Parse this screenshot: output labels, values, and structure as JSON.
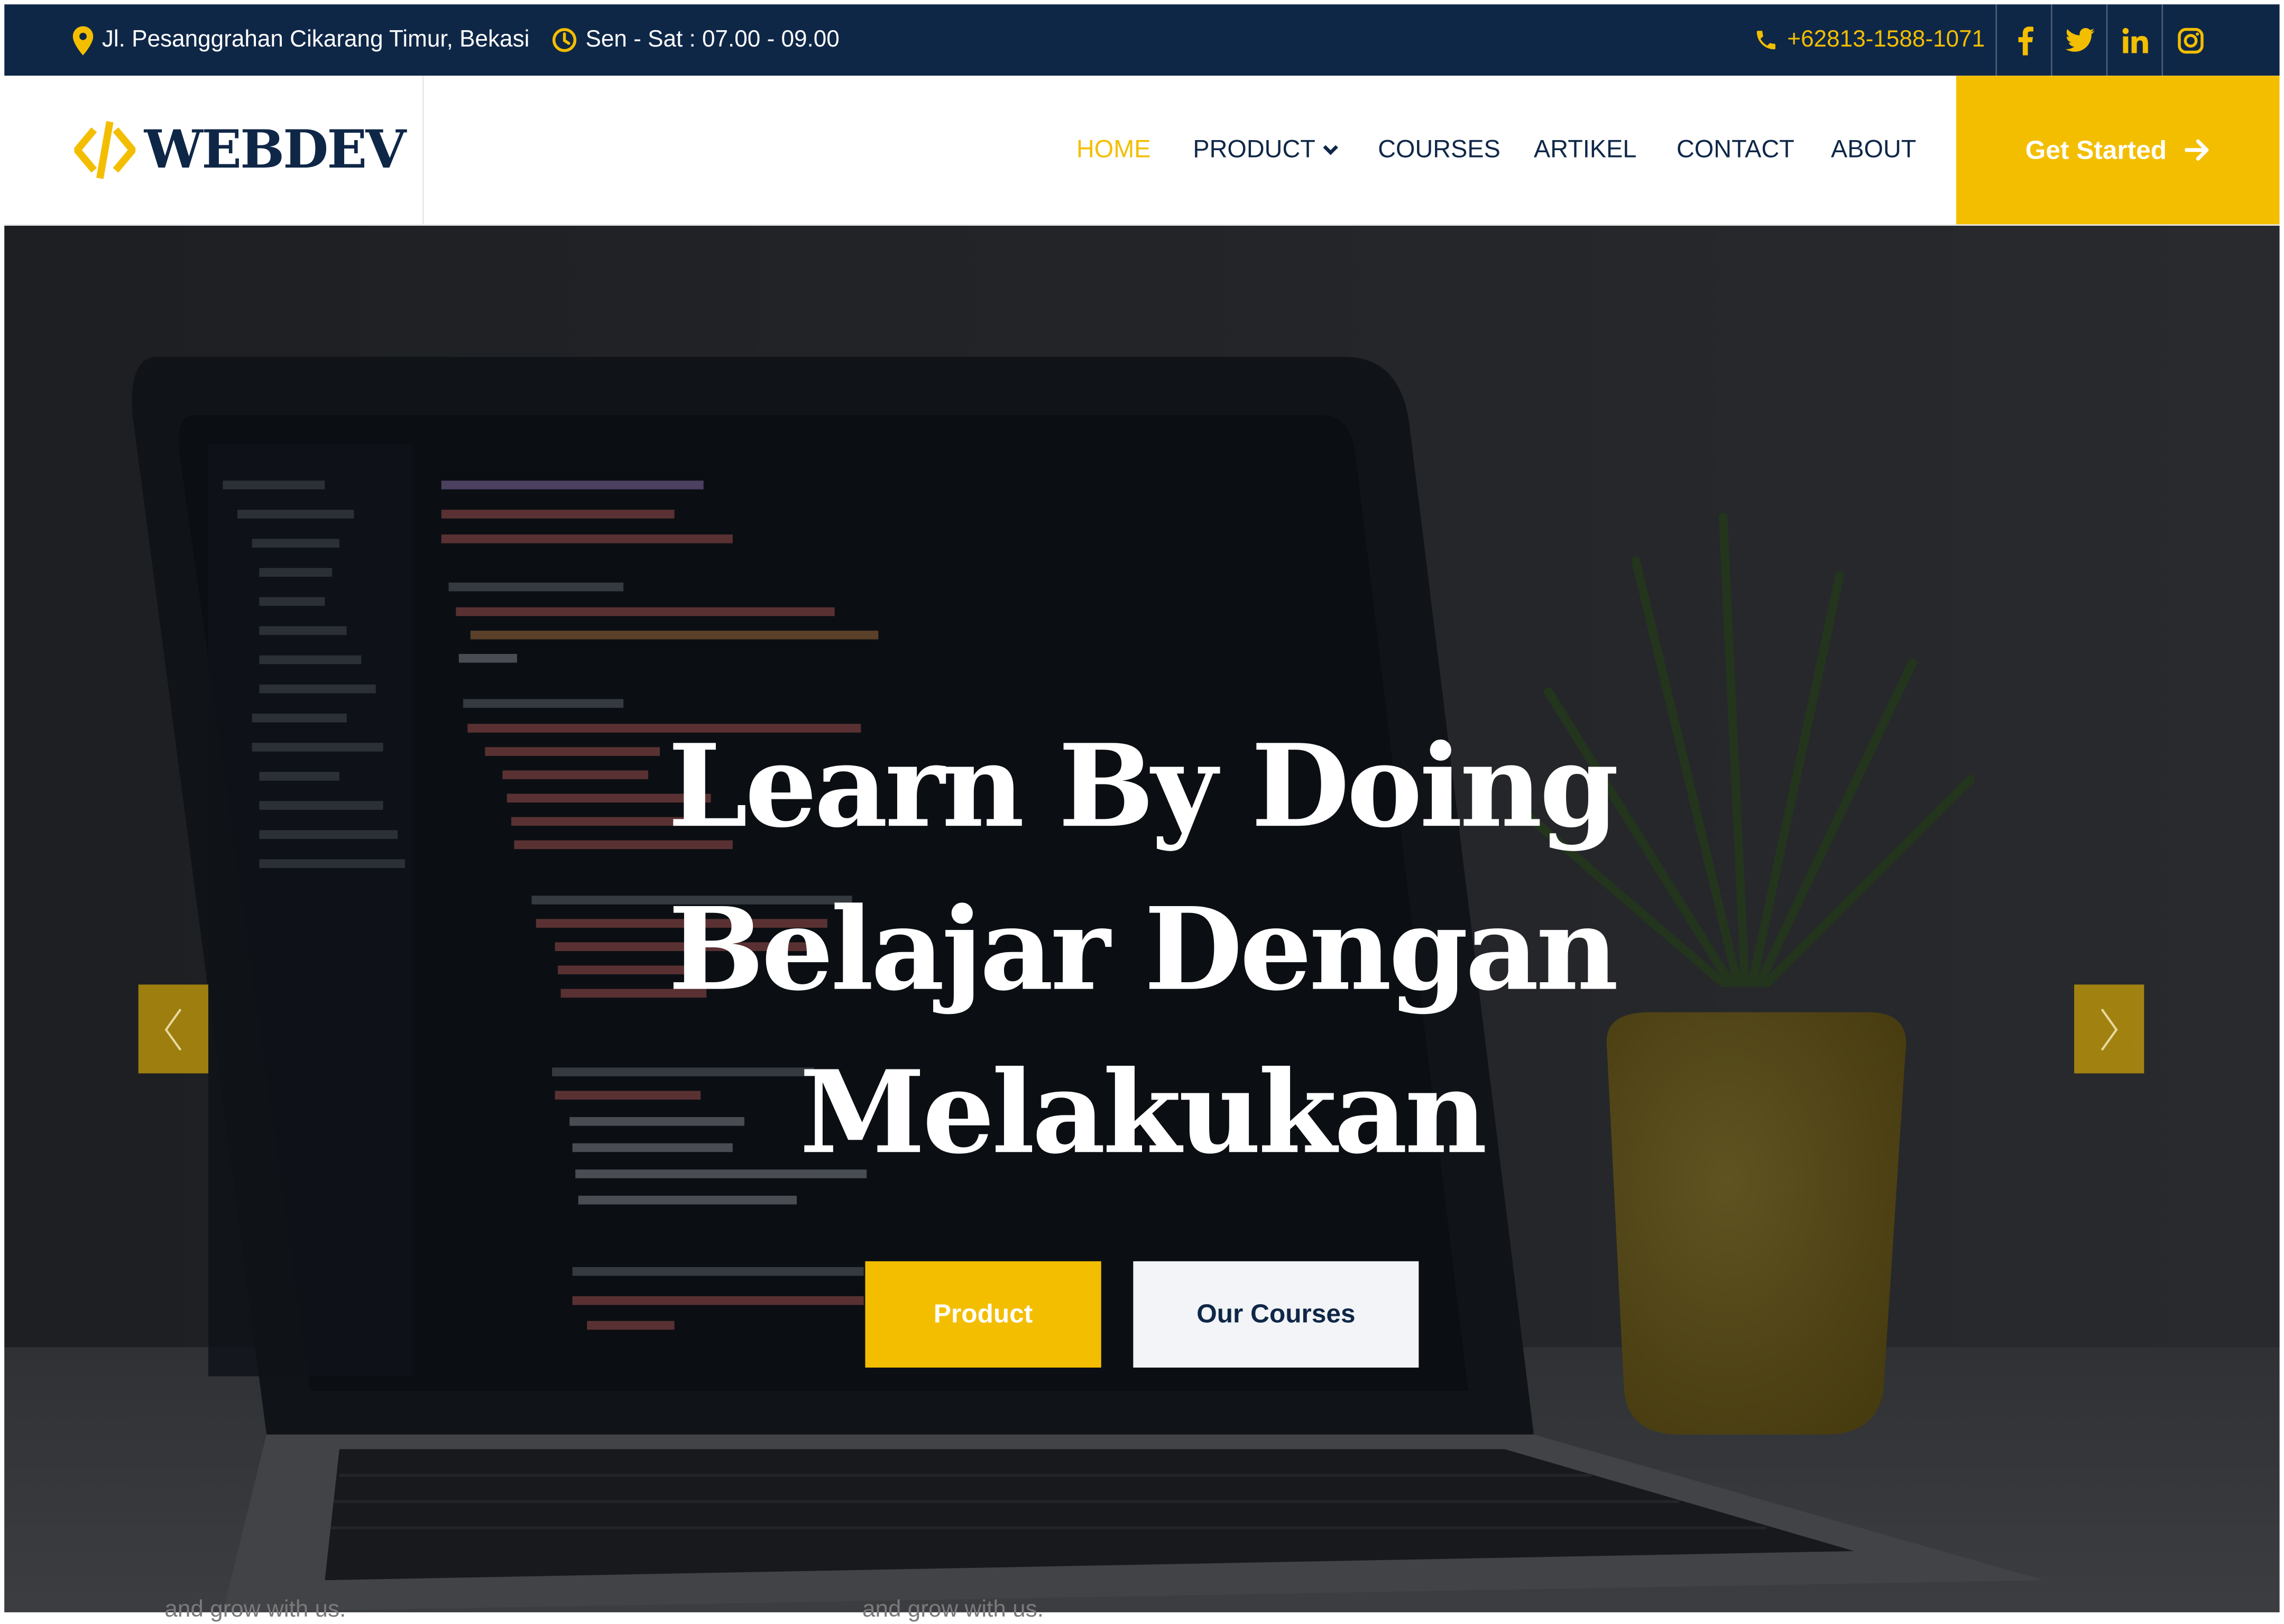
{
  "topbar": {
    "address": "Jl. Pesanggrahan Cikarang Timur, Bekasi",
    "hours": "Sen - Sat : 07.00 - 09.00",
    "phone": "+62813-1588-1071",
    "social": [
      "facebook-icon",
      "twitter-icon",
      "linkedin-icon",
      "instagram-icon"
    ]
  },
  "logo": {
    "text": "WEBDEV",
    "icon": "code-brackets-icon"
  },
  "nav": {
    "items": [
      {
        "label": "HOME",
        "active": true
      },
      {
        "label": "PRODUCT",
        "dropdown": true
      },
      {
        "label": "COURSES"
      },
      {
        "label": "ARTIKEL"
      },
      {
        "label": "CONTACT"
      },
      {
        "label": "ABOUT"
      }
    ],
    "cta": "Get Started"
  },
  "hero": {
    "title_lines": [
      "Learn By Doing",
      "Belajar Dengan",
      "Melakukan"
    ],
    "primary_button": "Product",
    "secondary_button": "Our Courses"
  },
  "below": {
    "left_text": "and grow with us.",
    "right_text": "and grow with us."
  },
  "colors": {
    "navy": "#0f2747",
    "accent": "#f3be00",
    "light": "#f2f4f7"
  }
}
